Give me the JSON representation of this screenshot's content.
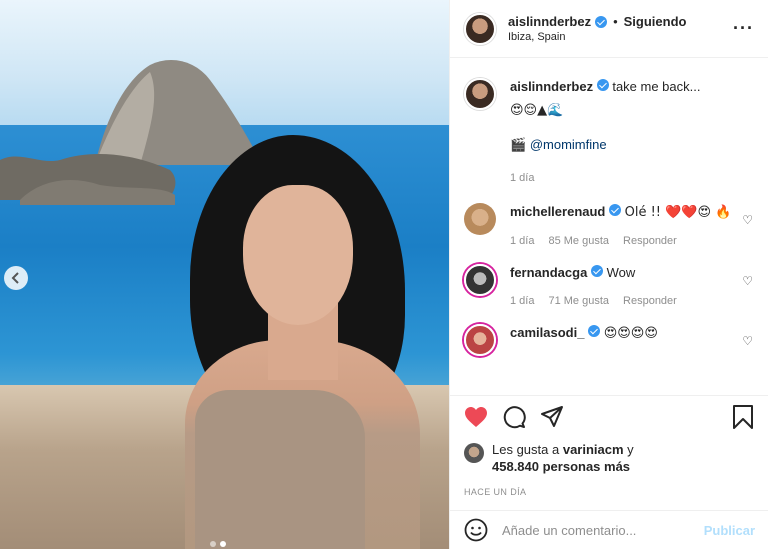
{
  "post": {
    "author": "aislinnderbez",
    "follow_status": "Siguiendo",
    "location": "Ibiza, Spain",
    "more_icon": "more-horizontal-icon"
  },
  "caption": {
    "username": "aislinnderbez",
    "text": "take me back...",
    "emojis": "😍😌▲🌊",
    "credit_icon": "camera-emoji",
    "credit_handle": "@momimfine",
    "time": "1 día"
  },
  "comments": [
    {
      "username": "michellerenaud",
      "text": "Olé !! ❤️❤️😍 🔥",
      "time": "1 día",
      "likes": "85 Me gusta",
      "reply": "Responder"
    },
    {
      "username": "fernandacga",
      "text": "Wow",
      "time": "1 día",
      "likes": "71 Me gusta",
      "reply": "Responder"
    },
    {
      "username": "camilasodi_",
      "text": "😍😍😍😍"
    }
  ],
  "actions": {
    "like_icon": "heart-filled-icon",
    "comment_icon": "comment-bubble-icon",
    "share_icon": "paper-plane-icon",
    "save_icon": "bookmark-icon",
    "like_color": "#ed4956"
  },
  "likes": {
    "prefix": "Les gusta a",
    "first_user": "variniacm",
    "connector": "y",
    "count_text": "458.840 personas más"
  },
  "timestamp": "HACE UN DÍA",
  "add_comment": {
    "placeholder": "Añade un comentario...",
    "publish_label": "Publicar"
  }
}
